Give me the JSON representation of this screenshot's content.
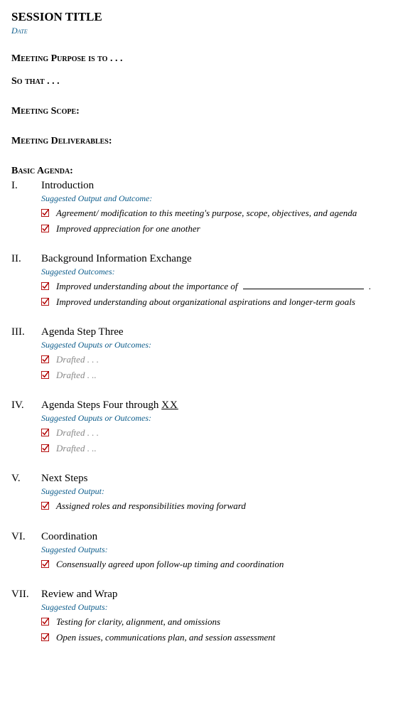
{
  "title": "SESSION TITLE",
  "date": "Date",
  "labels": {
    "purpose": "Meeting Purpose is to . . .",
    "sothat": "So that . . .",
    "scope": "Meeting Scope:",
    "deliverables": "Meeting Deliverables:",
    "agenda": "Basic Agenda:"
  },
  "agenda": [
    {
      "num": "I.",
      "title": "Introduction",
      "sub": "Suggested Output and Outcome:",
      "items": [
        {
          "text": "Agreement/ modification to this meeting's purpose, scope, objectives, and agenda",
          "gray": false
        },
        {
          "text": "Improved appreciation for one another",
          "gray": false
        }
      ]
    },
    {
      "num": "II.",
      "title": "Background Information Exchange",
      "sub": "Suggested Outcomes:",
      "items": [
        {
          "text_pre": "Improved understanding about the importance of ",
          "fill": true,
          "text_post": ".",
          "gray": false
        },
        {
          "text": "Improved understanding about organizational aspirations and longer-term goals",
          "gray": false
        }
      ]
    },
    {
      "num": "III.",
      "title": "Agenda Step Three",
      "sub": "Suggested Ouputs or Outcomes:",
      "items": [
        {
          "text": "Drafted . . .",
          "gray": true
        },
        {
          "text": "Drafted . ..",
          "gray": true
        }
      ]
    },
    {
      "num": "IV.",
      "title_pre": "Agenda Steps Four through ",
      "title_xx": "XX",
      "sub": "Suggested Ouputs or Outcomes:",
      "items": [
        {
          "text": "Drafted . . .",
          "gray": true
        },
        {
          "text": "Drafted . ..",
          "gray": true
        }
      ]
    },
    {
      "num": "V.",
      "title": "Next Steps",
      "sub": "Suggested Output:",
      "items": [
        {
          "text": "Assigned roles and responsibilities moving forward",
          "gray": false
        }
      ]
    },
    {
      "num": "VI.",
      "title": "Coordination",
      "sub": "Suggested Outputs:",
      "items": [
        {
          "text": "Consensually agreed upon follow-up timing and coordination",
          "gray": false
        }
      ]
    },
    {
      "num": "VII.",
      "title": "Review and Wrap",
      "sub": "Suggested Outputs:",
      "items": [
        {
          "text": "Testing for clarity, alignment, and omissions",
          "gray": false
        },
        {
          "text": "Open issues, communications plan, and session assessment",
          "gray": false
        }
      ]
    }
  ]
}
